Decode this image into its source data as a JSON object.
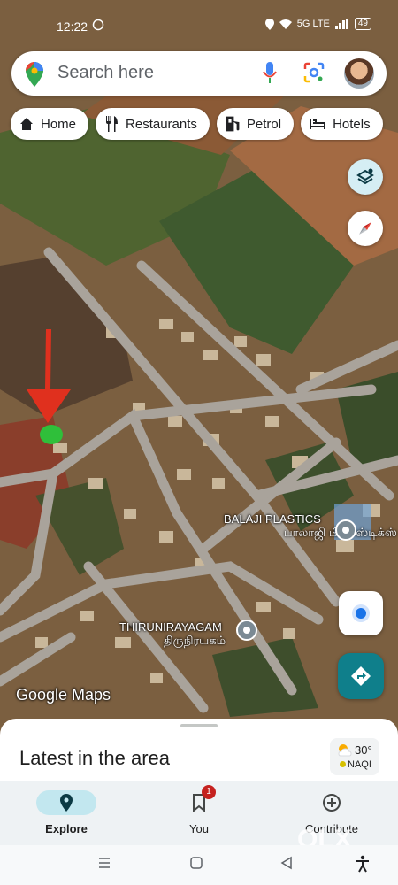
{
  "status_bar": {
    "time": "12:22",
    "network_label": "5G LTE",
    "battery": "49"
  },
  "search": {
    "placeholder": "Search here"
  },
  "chips": [
    {
      "label": "Home",
      "icon": "home-icon"
    },
    {
      "label": "Restaurants",
      "icon": "restaurant-icon"
    },
    {
      "label": "Petrol",
      "icon": "fuel-icon"
    },
    {
      "label": "Hotels",
      "icon": "hotel-icon"
    }
  ],
  "map": {
    "places": [
      {
        "name": "BALAJI PLASTICS",
        "local_name": "பாலாஜி பிளாஸ்டிக்ஸ்"
      },
      {
        "name": "THIRUNIRAYAGAM",
        "local_name": "திருநிரயகம்"
      }
    ],
    "attribution": "Google Maps",
    "annotation_color": "#e0301e",
    "marker_color": "#2fbf3a"
  },
  "sheet": {
    "title": "Latest in the area",
    "weather": {
      "temp": "30°",
      "aqi": "NAQI"
    }
  },
  "tabs": [
    {
      "label": "Explore",
      "icon": "explore-icon",
      "active": true
    },
    {
      "label": "You",
      "icon": "saved-icon",
      "badge": "1"
    },
    {
      "label": "Contribute",
      "icon": "contribute-icon"
    }
  ],
  "watermark": "OLX",
  "colors": {
    "accent": "#0f7f8b",
    "active_tab": "#c2e7ef",
    "my_location": "#1a73e8"
  }
}
